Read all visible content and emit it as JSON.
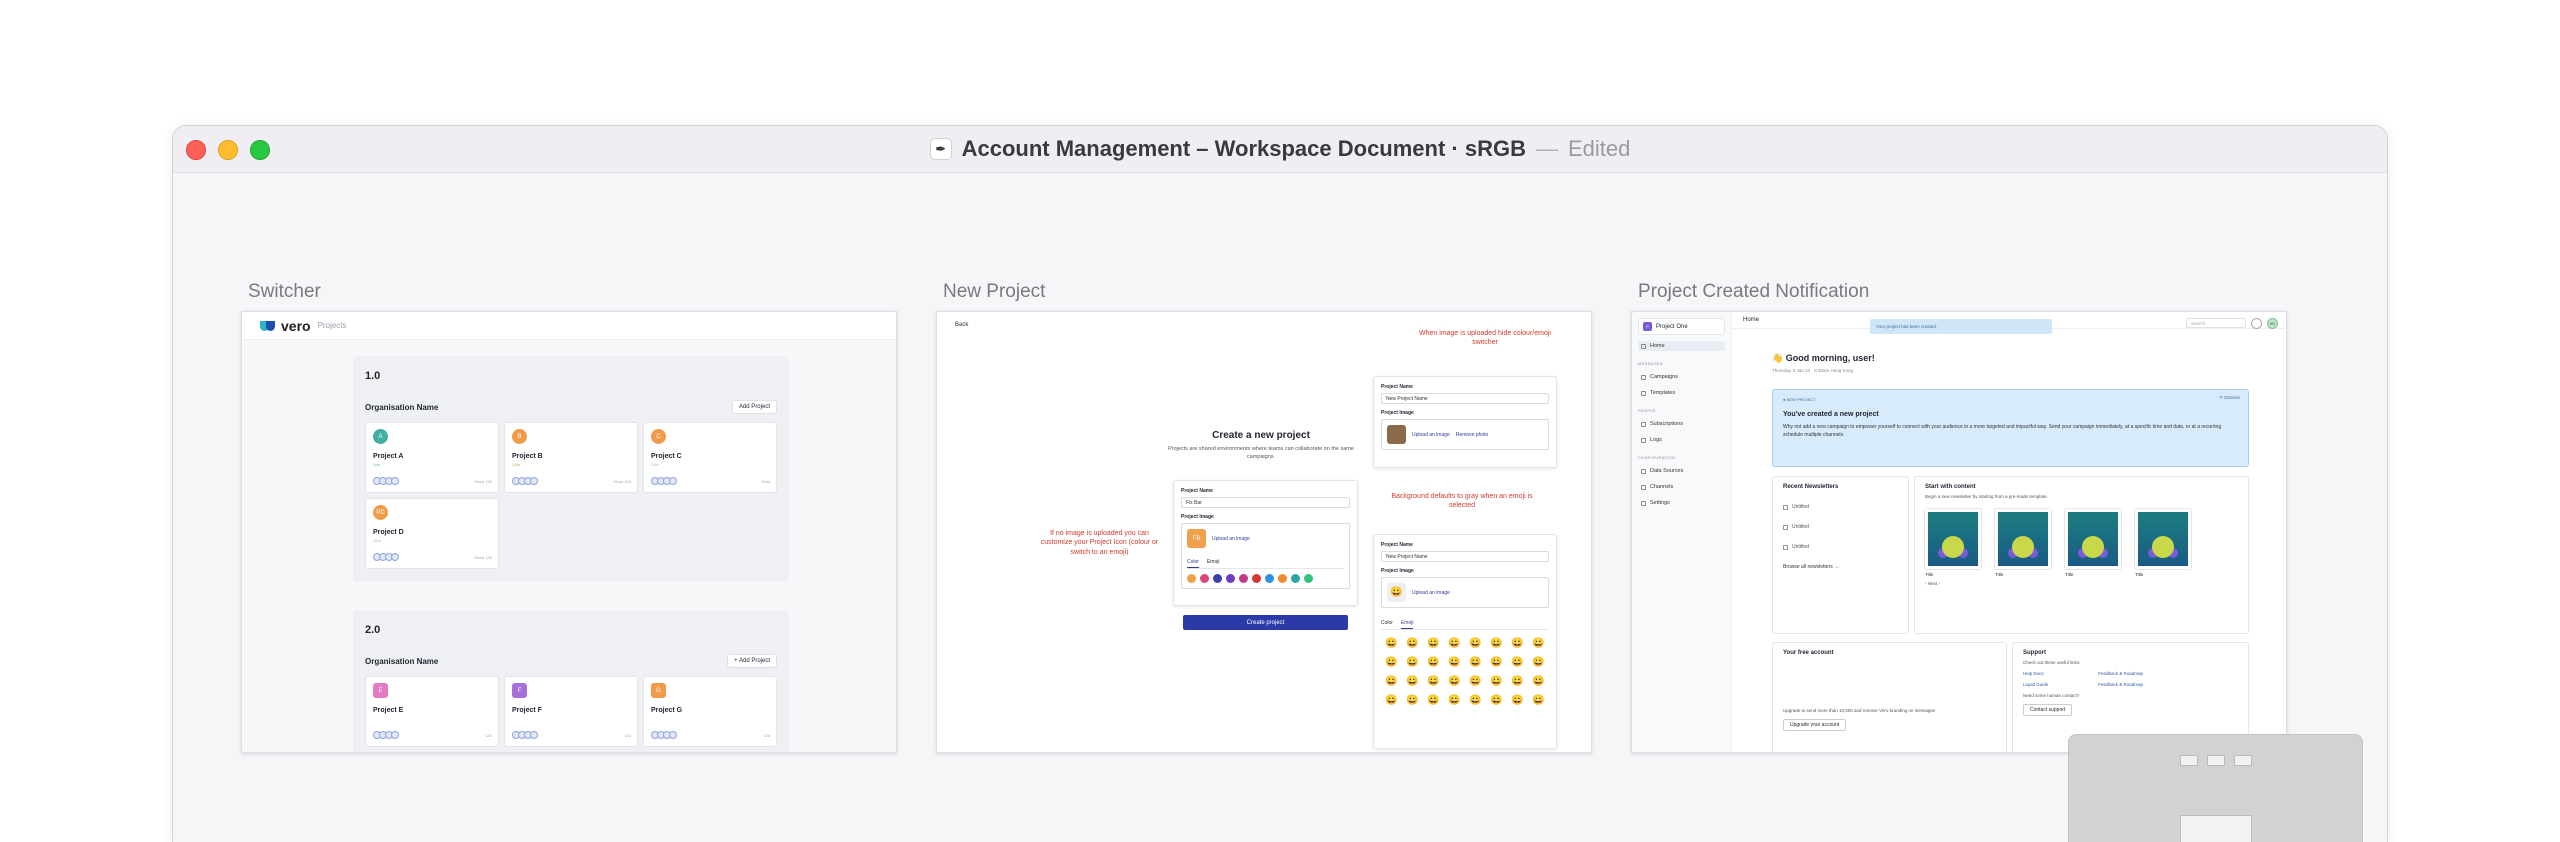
{
  "window": {
    "title": "Account Management – Workspace Document · sRGB",
    "separator": "—",
    "status": "Edited"
  },
  "frames": {
    "switcher": {
      "label": "Switcher",
      "logo": "vero",
      "logo_sub": "Projects",
      "sections": [
        {
          "version": "1.0",
          "org": "Organisation Name",
          "add_label": "Add Project",
          "projects": [
            {
              "initial": "A",
              "name": "Project A",
              "sub": "Live",
              "meta": "Since 12d",
              "color": "#3fb0a0"
            },
            {
              "initial": "B",
              "name": "Project B",
              "sub": "12m",
              "meta": "Since 12d",
              "color": "#f09a4a"
            },
            {
              "initial": "C",
              "name": "Project C",
              "sub": "12m",
              "meta": "12mi",
              "color": "#f09a4a"
            },
            {
              "initial": "PD",
              "name": "Project D",
              "sub": "12m",
              "meta": "Since 12d",
              "color": "#f09a4a"
            }
          ]
        },
        {
          "version": "2.0",
          "org": "Organisation Name",
          "add_label": "+ Add Project",
          "projects": [
            {
              "initial": "E",
              "name": "Project E",
              "sub": "",
              "meta": "12d",
              "color": "#e27bc4"
            },
            {
              "initial": "F",
              "name": "Project F",
              "sub": "",
              "meta": "12d",
              "color": "#a76fd8"
            },
            {
              "initial": "G",
              "name": "Project G",
              "sub": "",
              "meta": "12d",
              "color": "#f09a4a"
            }
          ]
        }
      ]
    },
    "new_project": {
      "label": "New Project",
      "back": "Back",
      "heading": "Create a new project",
      "description": "Projects are shared environments where teams can collaborate on the same campaigns.",
      "name_label": "Project Name",
      "name_value": "Fix Bar",
      "image_label": "Project Image",
      "tile_initials": "FB",
      "upload": "Upload an image",
      "remove": "Remove photo",
      "tab_color": "Color",
      "tab_emoji": "Emoji",
      "create": "Create project",
      "annot_left": "If no image is uploaded you can customize your Project Icon (colour or switch to an emoji)",
      "annot_top": "When image is uploaded hide colour/emoji switcher",
      "annot_mid": "Background defaults to gray when an emoji is selected",
      "name_value_2": "New Project Name",
      "colors": [
        "#f0a04a",
        "#e0457a",
        "#3b3fb0",
        "#6a3fc8",
        "#c23a8a",
        "#d8372e",
        "#2f8fe0",
        "#f08a2a",
        "#2aa7a0",
        "#2fc27a"
      ],
      "emoji": "😀"
    },
    "notification": {
      "label": "Project Created Notification",
      "project": "Project One",
      "nav": {
        "home": "Home",
        "g1": "MESSAGES",
        "campaigns": "Campaigns",
        "templates": "Templates",
        "g2": "PEOPLE",
        "subscriptions": "Subscriptions",
        "logs": "Logs",
        "g3": "CONFIGURATION",
        "data_sources": "Data Sources",
        "channels": "Channels",
        "settings": "Settings"
      },
      "crumb": "Home",
      "toast": "Your project has been created.",
      "search": "Search",
      "greeting": "👋 Good morning, user!",
      "date": "Thursday, 5 Jan 23 · 9:30am Hong Kong",
      "banner_badge": "● NEW PROJECT",
      "banner_title": "You've created a new project",
      "banner_text": "Why not add a new campaign to empower yourself to connect with your audience in a more targeted and impactful way. Send your campaign immediately, at a specific time and date, or at a recurring schedule multiple channels.",
      "dismiss": "✕ Dismiss",
      "recent": "Recent Newsletters",
      "untitled": "Untitled",
      "browse": "Browse all newsletters →",
      "start": "Start with content",
      "start_sub": "Begin a new newsletter by starting from a pre-made template.",
      "tpl": "Title",
      "pager": "‹ Next ›",
      "free": "Your free account",
      "free_text": "Upgrade to send more than 10,000 and remove Vero branding on messages",
      "upgrade": "Upgrade your account",
      "support": "Support",
      "support_sub": "Check out these useful links:",
      "help": "Help Docs",
      "liquid": "Liquid Guide",
      "feedback": "Feedback & Roadmap",
      "feedback2": "Feedback & Roadmap",
      "human": "Need some human contact?",
      "contact": "Contact support",
      "avatar": "VC"
    }
  },
  "icons": {
    "doc": "pen-nib-icon"
  }
}
